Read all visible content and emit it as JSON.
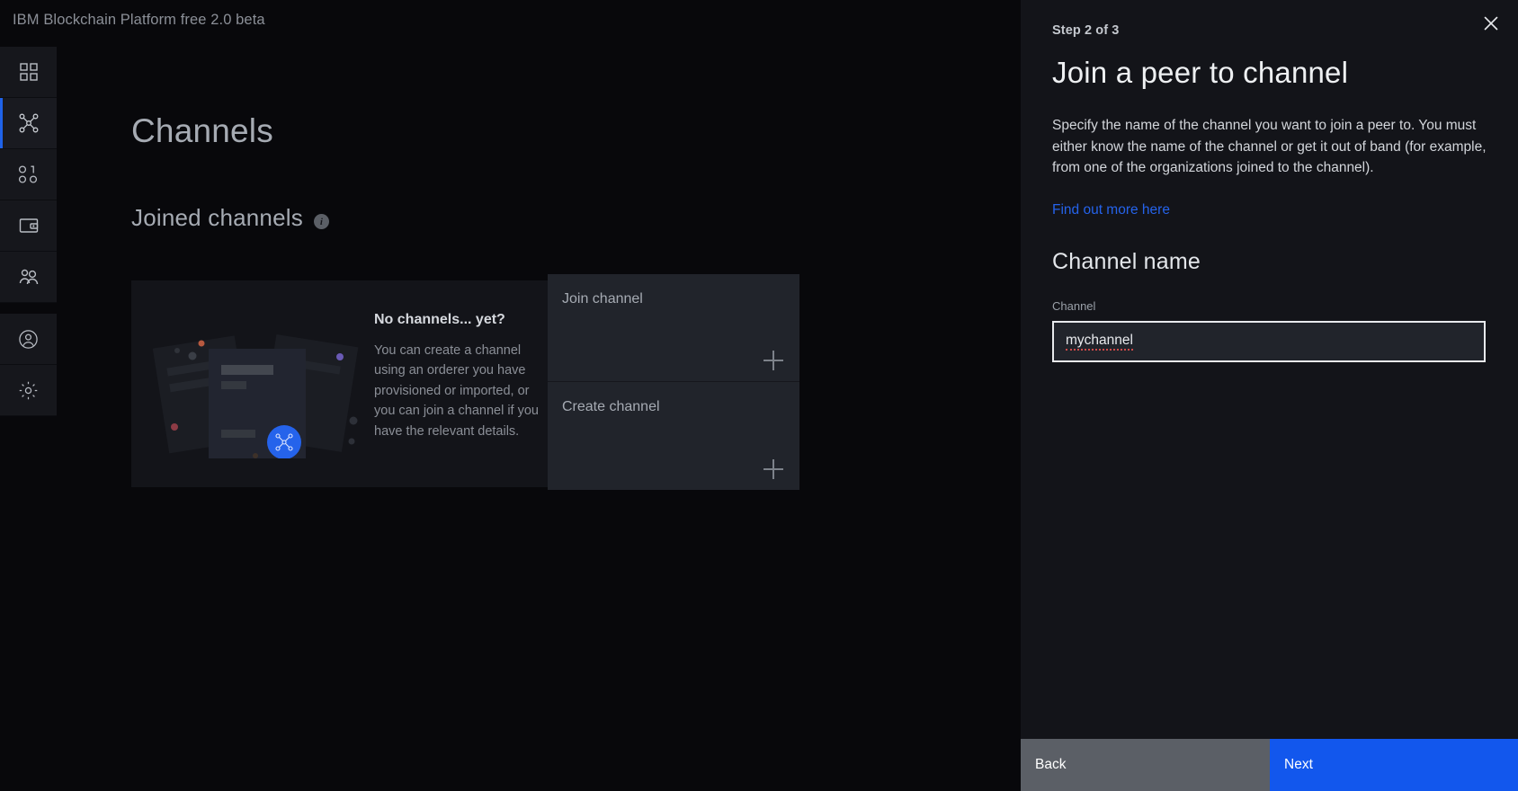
{
  "app": {
    "title": "IBM Blockchain Platform free 2.0 beta",
    "accent_blue": "#1257ed",
    "link_blue": "#2563eb",
    "panel_bg": "#131419",
    "page_bg": "#08080b"
  },
  "sidebar": {
    "primary_items": [
      {
        "icon": "dashboard-grid-icon",
        "name": "dashboard",
        "active": false
      },
      {
        "icon": "network-nodes-icon",
        "name": "channels",
        "active": true
      },
      {
        "icon": "binary-code-icon",
        "name": "smart-contracts",
        "active": false
      },
      {
        "icon": "wallet-icon",
        "name": "wallet",
        "active": false
      },
      {
        "icon": "users-icon",
        "name": "organizations",
        "active": false
      }
    ],
    "secondary_items": [
      {
        "icon": "user-account-icon",
        "name": "account",
        "active": false
      },
      {
        "icon": "gear-icon",
        "name": "settings",
        "active": false
      }
    ]
  },
  "main": {
    "page_title": "Channels",
    "section_title": "Joined channels",
    "info_glyph": "i",
    "empty_state": {
      "title": "No channels... yet?",
      "body": "You can create a channel using an orderer you have provisioned or imported, or you can join a channel if you have the relevant details."
    },
    "tiles": [
      {
        "label": "Join channel",
        "icon": "plus-icon"
      },
      {
        "label": "Create channel",
        "icon": "plus-icon"
      }
    ]
  },
  "panel": {
    "step": "Step 2 of 3",
    "title": "Join a peer to channel",
    "description": "Specify the name of the channel you want to join a peer to. You must either know the name of the channel or get it out of band (for example, from one of the organizations joined to the channel).",
    "link": "Find out more here",
    "field_heading": "Channel name",
    "field_label": "Channel",
    "field_value": "mychannel",
    "field_placeholder": "",
    "close_icon": "close-icon",
    "buttons": {
      "back": "Back",
      "next": "Next"
    }
  }
}
